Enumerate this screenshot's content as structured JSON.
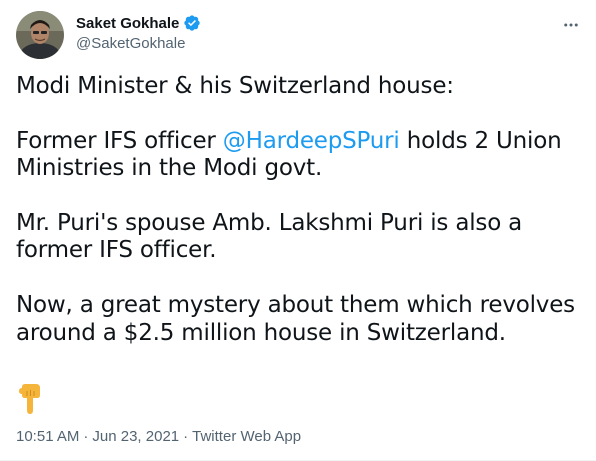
{
  "user": {
    "display_name": "Saket Gokhale",
    "handle": "@SaketGokhale",
    "verified": true,
    "avatar_icon": "profile-photo"
  },
  "more_icon": "ellipsis-icon",
  "tweet": {
    "line1": "Modi Minister & his Switzerland house:",
    "para2_prefix": "Former IFS officer ",
    "para2_mention": "@HardeepSPuri",
    "para2_suffix": " holds 2 Union Ministries in the Modi govt.",
    "para3": "Mr. Puri's spouse Amb. Lakshmi Puri is also a former IFS officer.",
    "para4": "Now, a great mystery about them which revolves around a $2.5 million house in Switzerland.",
    "emoji_icon": "backhand-index-pointing-down-icon"
  },
  "meta": {
    "time": "10:51 AM",
    "separator1": "·",
    "date": "Jun 23, 2021",
    "separator2": "·",
    "source": "Twitter Web App"
  },
  "colors": {
    "link": "#1d9bf0",
    "secondary_text": "#536471",
    "primary_text": "#0f1419"
  }
}
